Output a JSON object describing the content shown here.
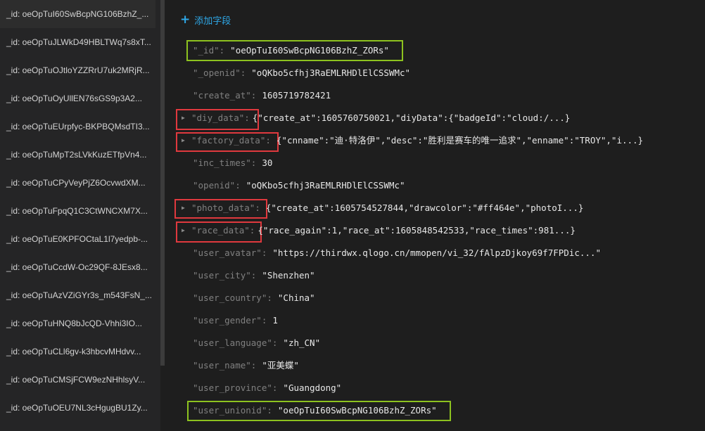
{
  "sidebar": {
    "items": [
      "_id: oeOpTuI60SwBcpNG106BzhZ_...",
      "_id: oeOpTuJLWkD49HBLTWq7s8xT...",
      "_id: oeOpTuOJtloYZZRrU7uk2MRjR...",
      "_id: oeOpTuOyUllEN76sGS9p3A2...",
      "_id: oeOpTuEUrpfyc-BKPBQMsdTI3...",
      "_id: oeOpTuMpT2sLVkKuzETfpVn4...",
      "_id: oeOpTuCPyVeyPjZ6OcvwdXM...",
      "_id: oeOpTuFpqQ1C3CtWNCXM7X...",
      "_id: oeOpTuE0KPFOCtaL1l7yedpb-...",
      "_id: oeOpTuCcdW-Oc29QF-8JEsx8...",
      "_id: oeOpTuAzVZiGYr3s_m543FsN_...",
      "_id: oeOpTuHNQ8bJcQD-Vhhi3IO...",
      "_id: oeOpTuCLl6gv-k3hbcvMHdvv...",
      "_id: oeOpTuCMSjFCW9ezNHhlsyV...",
      "_id: oeOpTuOEU7NL3cHgugBU1Zy..."
    ]
  },
  "toolbar": {
    "add_field_label": "添加字段",
    "add_icon": "plus-icon"
  },
  "fields": {
    "id": {
      "key": "\"_id\"",
      "value": "\"oeOpTuI60SwBcpNG106BzhZ_ZORs\""
    },
    "openid_": {
      "key": "\"_openid\"",
      "value": "\"oQKbo5cfhj3RaEMLRHDlElCSSWMc\""
    },
    "create_at": {
      "key": "\"create_at\"",
      "value": "1605719782421"
    },
    "diy_data": {
      "key": "\"diy_data\"",
      "value": "{\"create_at\":1605760750021,\"diyData\":{\"badgeId\":\"cloud:/...}"
    },
    "factory_data": {
      "key": "\"factory_data\"",
      "value": "{\"cnname\":\"迪·特洛伊\",\"desc\":\"胜利是赛车的唯一追求\",\"enname\":\"TROY\",\"i...}"
    },
    "inc_times": {
      "key": "\"inc_times\"",
      "value": "30"
    },
    "openid": {
      "key": "\"openid\"",
      "value": "\"oQKbo5cfhj3RaEMLRHDlElCSSWMc\""
    },
    "photo_data": {
      "key": "\"photo_data\"",
      "value": "{\"create_at\":1605754527844,\"drawcolor\":\"#ff464e\",\"photoI...}"
    },
    "race_data": {
      "key": "\"race_data\"",
      "value": "{\"race_again\":1,\"race_at\":1605848542533,\"race_times\":981...}"
    },
    "user_avatar": {
      "key": "\"user_avatar\"",
      "value": "\"https://thirdwx.qlogo.cn/mmopen/vi_32/fAlpzDjkoy69f7FPDic...\""
    },
    "user_city": {
      "key": "\"user_city\"",
      "value": "\"Shenzhen\""
    },
    "user_country": {
      "key": "\"user_country\"",
      "value": "\"China\""
    },
    "user_gender": {
      "key": "\"user_gender\"",
      "value": "1"
    },
    "user_language": {
      "key": "\"user_language\"",
      "value": "\"zh_CN\""
    },
    "user_name": {
      "key": "\"user_name\"",
      "value": "\"亚美蝶\""
    },
    "user_province": {
      "key": "\"user_province\"",
      "value": "\"Guangdong\""
    },
    "user_unionid": {
      "key": "\"user_unionid\"",
      "value": "\"oeOpTuI60SwBcpNG106BzhZ_ZORs\""
    }
  },
  "colors": {
    "highlight_green": "#8dc21f",
    "highlight_red": "#e0393e",
    "accent": "#2ea8e8"
  }
}
